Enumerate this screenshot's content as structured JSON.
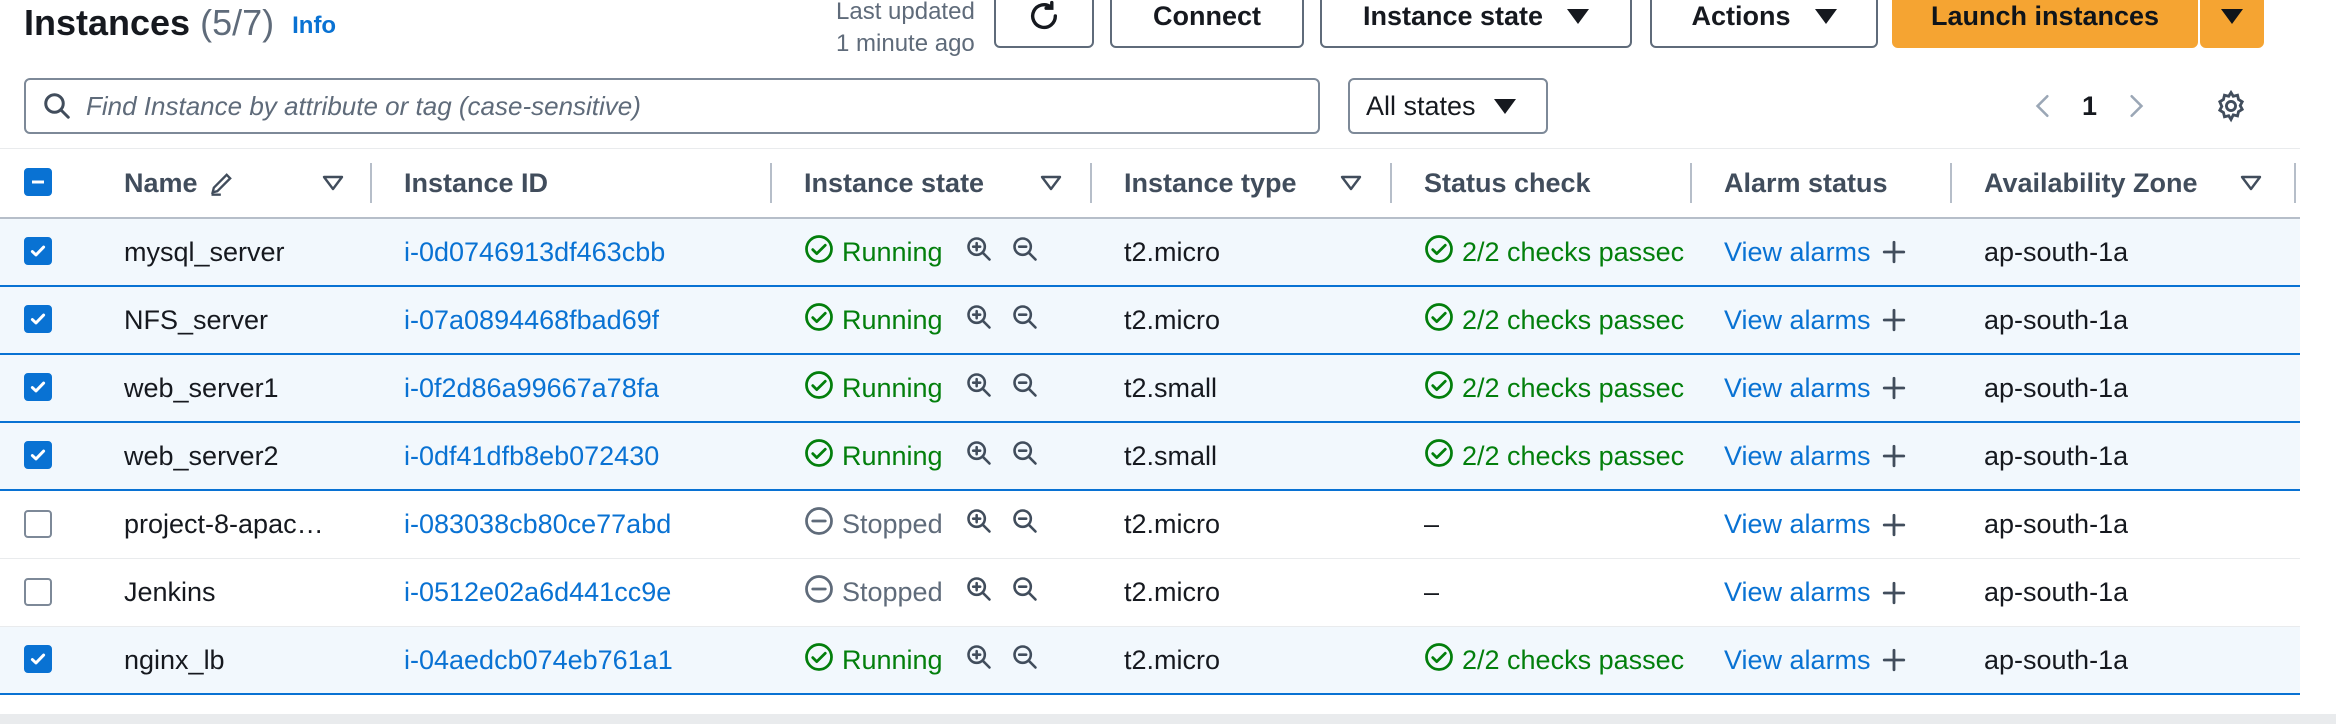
{
  "header": {
    "title": "Instances",
    "count": "(5/7)",
    "info": "Info",
    "last_updated_line1": "Last updated",
    "last_updated_line2": "1 minute ago",
    "connect": "Connect",
    "instance_state": "Instance state",
    "actions": "Actions",
    "launch": "Launch instances"
  },
  "filter": {
    "search_placeholder": "Find Instance by attribute or tag (case-sensitive)",
    "state_select": "All states",
    "page": "1"
  },
  "columns": {
    "name": "Name",
    "instance_id": "Instance ID",
    "instance_state": "Instance state",
    "instance_type": "Instance type",
    "status_check": "Status check",
    "alarm_status": "Alarm status",
    "availability_zone": "Availability Zone"
  },
  "alarm_link": "View alarms",
  "rows": [
    {
      "selected": true,
      "name": "mysql_server",
      "id": "i-0d0746913df463cbb",
      "state": "Running",
      "type": "t2.micro",
      "check": "2/2 checks passec",
      "az": "ap-south-1a"
    },
    {
      "selected": true,
      "name": "NFS_server",
      "id": "i-07a0894468fbad69f",
      "state": "Running",
      "type": "t2.micro",
      "check": "2/2 checks passec",
      "az": "ap-south-1a"
    },
    {
      "selected": true,
      "name": "web_server1",
      "id": "i-0f2d86a99667a78fa",
      "state": "Running",
      "type": "t2.small",
      "check": "2/2 checks passec",
      "az": "ap-south-1a"
    },
    {
      "selected": true,
      "name": "web_server2",
      "id": "i-0df41dfb8eb072430",
      "state": "Running",
      "type": "t2.small",
      "check": "2/2 checks passec",
      "az": "ap-south-1a"
    },
    {
      "selected": false,
      "name": "project-8-apac…",
      "id": "i-083038cb80ce77abd",
      "state": "Stopped",
      "type": "t2.micro",
      "check": "–",
      "az": "ap-south-1a"
    },
    {
      "selected": false,
      "name": "Jenkins",
      "id": "i-0512e02a6d441cc9e",
      "state": "Stopped",
      "type": "t2.micro",
      "check": "–",
      "az": "ap-south-1a"
    },
    {
      "selected": true,
      "name": "nginx_lb",
      "id": "i-04aedcb074eb761a1",
      "state": "Running",
      "type": "t2.micro",
      "check": "2/2 checks passec",
      "az": "ap-south-1a"
    }
  ],
  "colors": {
    "link": "#0972d3",
    "success": "#037f0c",
    "stopped": "#5f6b7a",
    "primary": "#f5a432",
    "selected_row_bg": "#f2f8fd"
  },
  "icons": [
    "refresh-icon",
    "search-icon",
    "chevron-left-icon",
    "chevron-right-icon",
    "gear-icon",
    "edit-pencil-icon",
    "sort-caret-icon",
    "check-circle-icon",
    "stop-circle-icon",
    "zoom-in-icon",
    "zoom-out-icon",
    "plus-icon"
  ]
}
